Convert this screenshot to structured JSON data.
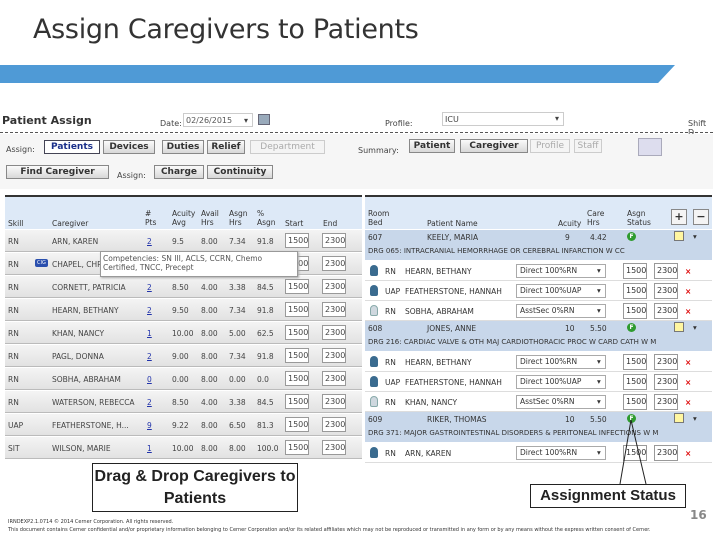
{
  "slide": {
    "title": "Assign Caregivers to Patients",
    "page_number": "16",
    "footer_id": "IRNDEXP2.1.0714   © 2014 Cerner Corporation. All rights reserved.",
    "footer_disclaimer": "This document contains Cerner confidential and/or proprietary information belonging to Cerner Corporation and/or its related affiliates which may not be reproduced or transmitted in any form or by any means without the express written consent of Cerner.",
    "accent": "#4f9ad6"
  },
  "app": {
    "title": "Patient Assign",
    "date_label": "Date:",
    "date_value": "02/26/2015",
    "profile_label": "Profile:",
    "profile_value": "ICU",
    "shift_label": "Shift D",
    "assign_label": "Assign:",
    "assign_tabs": [
      "Patients",
      "Devices",
      "Duties",
      "Relief",
      "Department"
    ],
    "summary_label": "Summary:",
    "summary_tabs": [
      "Patient",
      "Caregiver",
      "Profile",
      "Staff"
    ],
    "find_caregiver": "Find Caregiver",
    "assign2_label": "Assign:",
    "charge": "Charge",
    "continuity": "Continuity"
  },
  "caregivers": {
    "headers": {
      "skill": "Skill",
      "caregiver": "Caregiver",
      "pts": "# Pts",
      "acuity": "Acuity Avg",
      "avail": "Avail Hrs",
      "asgn": "Asgn Hrs",
      "pct": "% Asgn",
      "start": "Start",
      "end": "End"
    },
    "rows": [
      [
        "RN",
        "ARN, KAREN",
        "2",
        "9.5",
        "8.00",
        "7.34",
        "91.8",
        "1500",
        "2300"
      ],
      [
        "RN",
        "CHAPEL, CHRIS",
        "",
        "",
        "",
        "",
        "",
        "1500",
        "2300"
      ],
      [
        "RN",
        "CORNETT, PATRICIA",
        "2",
        "8.50",
        "4.00",
        "3.38",
        "84.5",
        "1500",
        "2300"
      ],
      [
        "RN",
        "HEARN, BETHANY",
        "2",
        "9.50",
        "8.00",
        "7.34",
        "91.8",
        "1500",
        "2300"
      ],
      [
        "RN",
        "KHAN, NANCY",
        "1",
        "10.00",
        "8.00",
        "5.00",
        "62.5",
        "1500",
        "2300"
      ],
      [
        "RN",
        "PAGL, DONNA",
        "2",
        "9.00",
        "8.00",
        "7.34",
        "91.8",
        "1500",
        "2300"
      ],
      [
        "RN",
        "SOBHA, ABRAHAM",
        "0",
        "0.00",
        "8.00",
        "0.00",
        "0.0",
        "1500",
        "2300"
      ],
      [
        "RN",
        "WATERSON, REBECCA",
        "2",
        "8.50",
        "4.00",
        "3.38",
        "84.5",
        "1500",
        "2300"
      ],
      [
        "UAP",
        "FEATHERSTONE, H...",
        "9",
        "9.22",
        "8.00",
        "6.50",
        "81.3",
        "1500",
        "2300"
      ],
      [
        "SIT",
        "WILSON, MARIE",
        "1",
        "10.00",
        "8.00",
        "8.00",
        "100.0",
        "1500",
        "2300"
      ]
    ],
    "badge": "CIG",
    "tooltip": "Competencies: SN III, ACLS, CCRN, Chemo Certified, TNCC, Precept"
  },
  "patients": {
    "headers": {
      "room": "Room Bed",
      "name": "Patient Name",
      "acuity": "Acuity",
      "care": "Care Hrs",
      "status": "Asgn Status"
    },
    "add": "+",
    "remove": "−",
    "groups": [
      {
        "room": "607",
        "name": "KEELY, MARIA",
        "acuity": "9",
        "care": "4.42",
        "status": "F",
        "drg": "DRG 065: INTRACRANIAL HEMORRHAGE OR CEREBRAL INFARCTION W CC",
        "assigned": [
          [
            "RN",
            "HEARN, BETHANY",
            "Direct 100%RN",
            "1500",
            "2300",
            "dark"
          ],
          [
            "UAP",
            "FEATHERSTONE, HANNAH",
            "Direct 100%UAP",
            "1500",
            "2300",
            "dark"
          ],
          [
            "RN",
            "SOBHA, ABRAHAM",
            "AsstSec 0%RN",
            "1500",
            "2300",
            "light"
          ]
        ]
      },
      {
        "room": "608",
        "name": "JONES, ANNE",
        "acuity": "10",
        "care": "5.50",
        "status": "F",
        "drg": "DRG 216: CARDIAC VALVE & OTH MAJ CARDIOTHORACIC PROC W CARD CATH W M",
        "assigned": [
          [
            "RN",
            "HEARN, BETHANY",
            "Direct 100%RN",
            "1500",
            "2300",
            "dark"
          ],
          [
            "UAP",
            "FEATHERSTONE, HANNAH",
            "Direct 100%UAP",
            "1500",
            "2300",
            "dark"
          ],
          [
            "RN",
            "KHAN, NANCY",
            "AsstSec 0%RN",
            "1500",
            "2300",
            "light"
          ]
        ]
      },
      {
        "room": "609",
        "name": "RIKER, THOMAS",
        "acuity": "10",
        "care": "5.50",
        "status": "F",
        "drg": "DRG 371: MAJOR GASTROINTESTINAL DISORDERS & PERITONEAL INFECTIONS W M",
        "assigned": [
          [
            "RN",
            "ARN, KAREN",
            "Direct 100%RN",
            "1500",
            "2300",
            "dark"
          ]
        ]
      }
    ]
  },
  "callouts": {
    "drag_drop": "Drag & Drop Caregivers to Patients",
    "status": "Assignment Status"
  }
}
